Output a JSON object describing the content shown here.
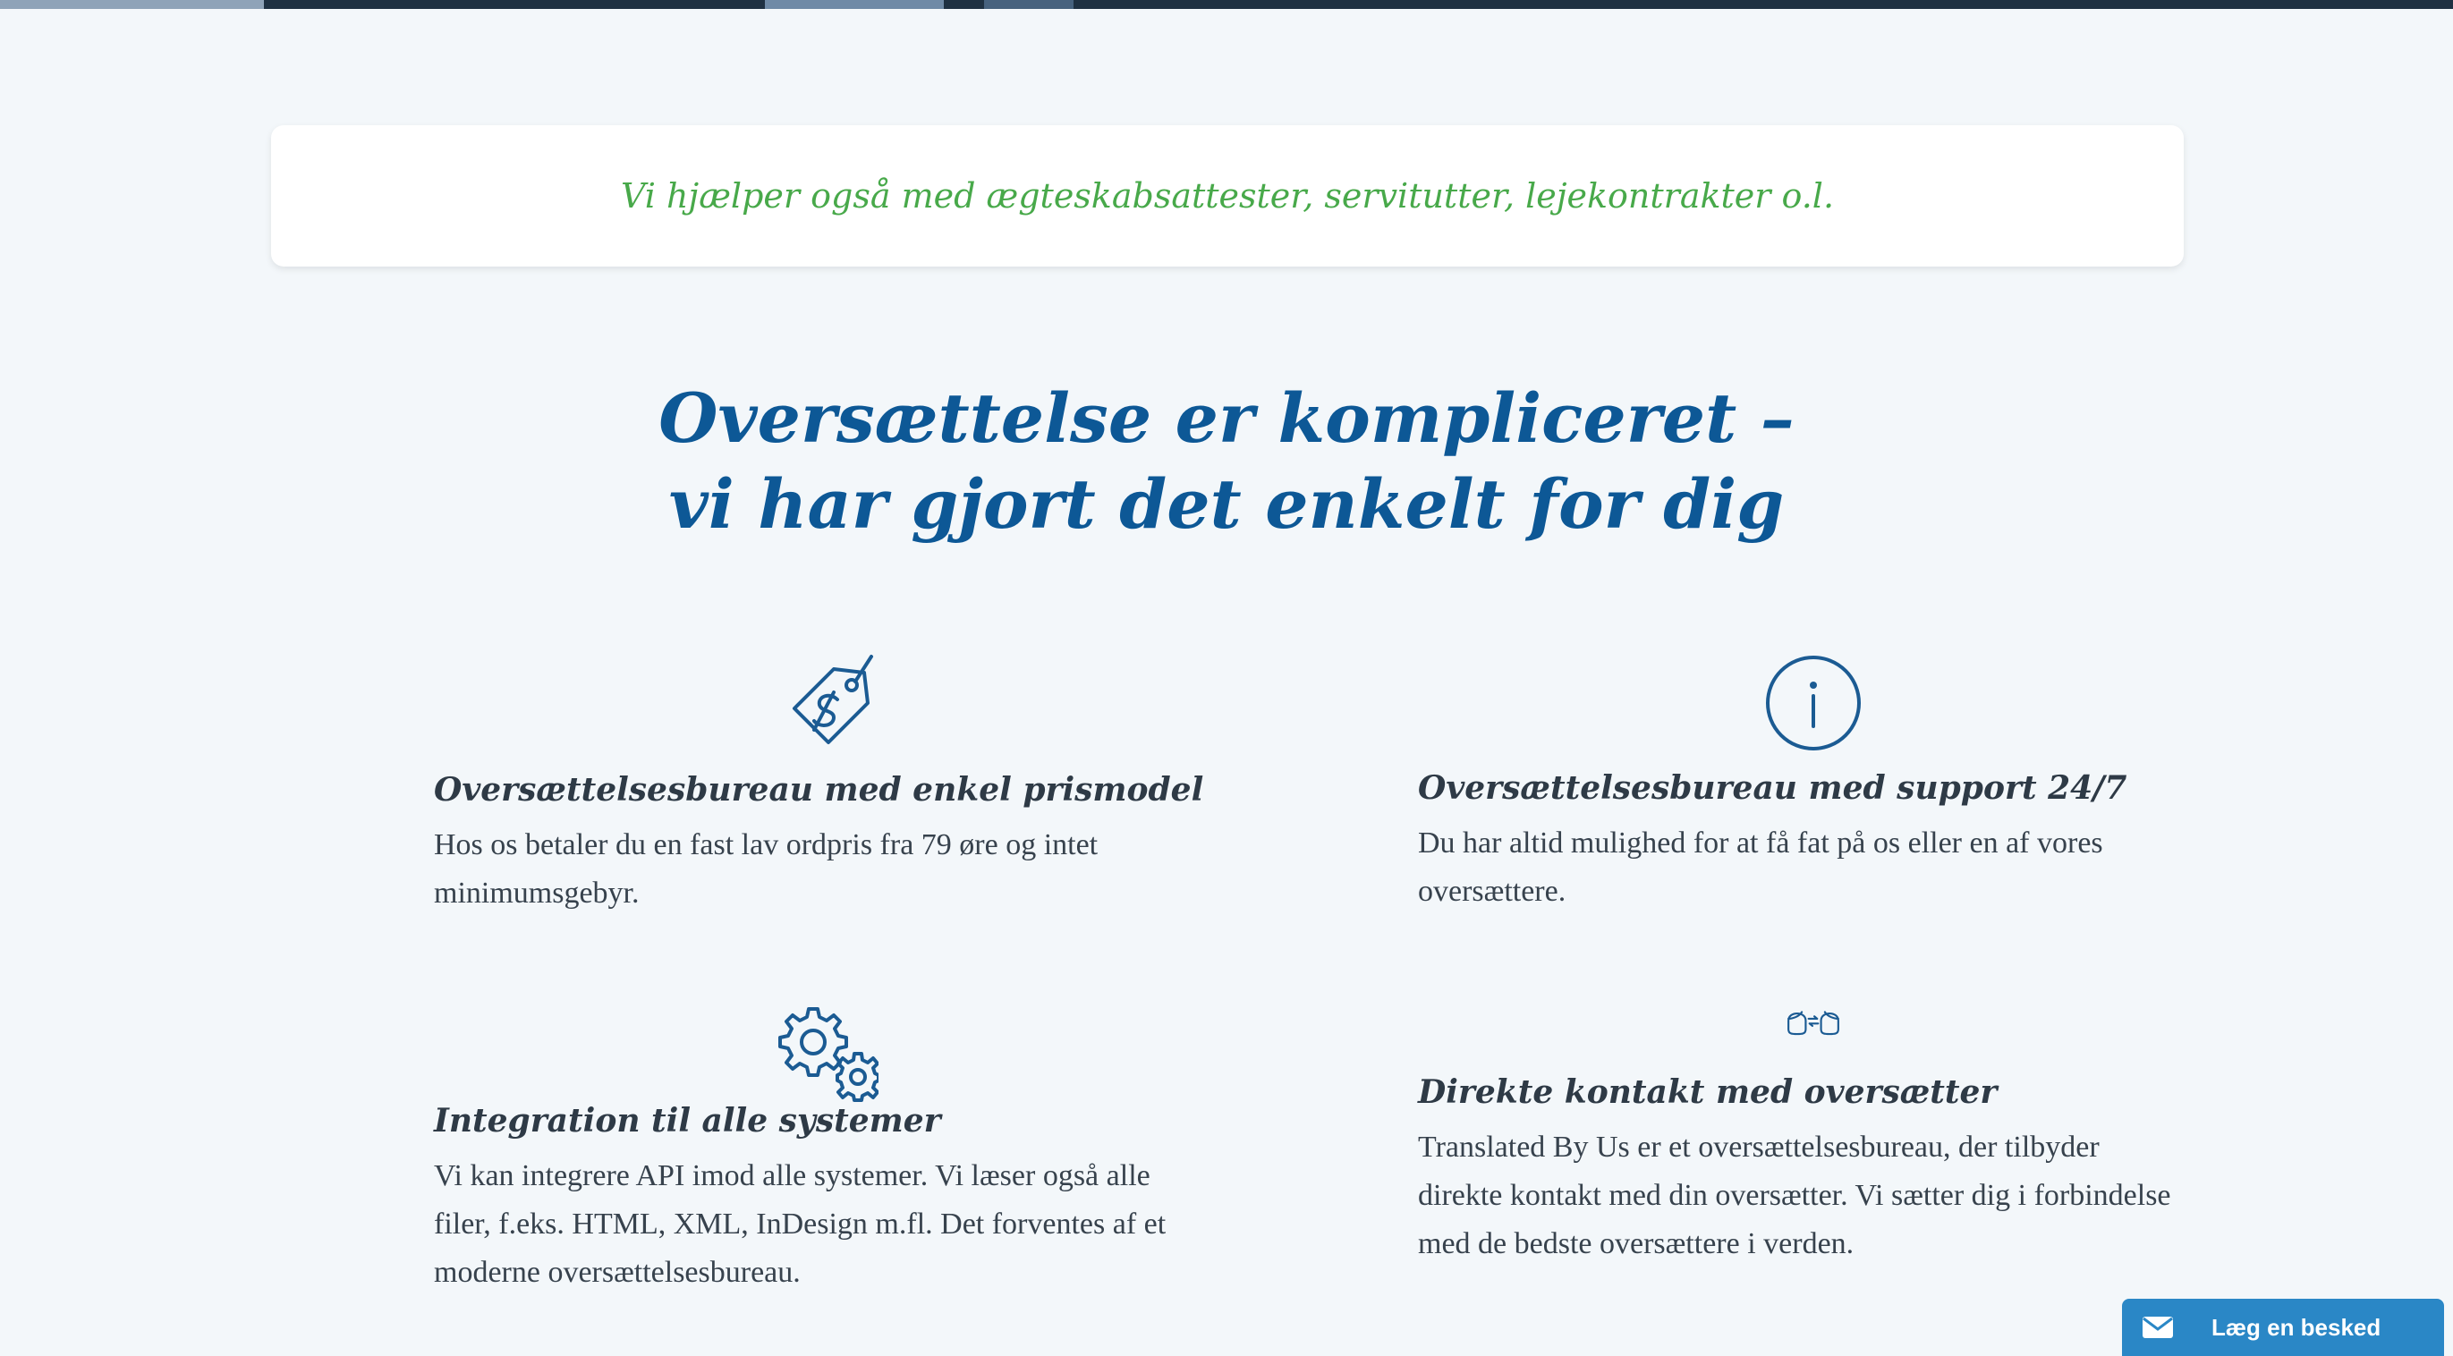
{
  "banner": {
    "text": "Vi hjælper også med ægteskabsattester, servitutter, lejekontrakter o.l."
  },
  "headline": {
    "line1": "Oversættelse er kompliceret –",
    "line2": "vi har gjort det enkelt for dig"
  },
  "features": [
    {
      "icon": "price-tag-icon",
      "title": "Oversættelsesbureau med enkel prismodel",
      "text": "Hos os betaler du en fast lav ordpris fra 79 øre og intet minimumsgebyr."
    },
    {
      "icon": "info-icon",
      "title": "Oversættelsesbureau med support 24/7",
      "text": "Du har altid mulighed for at få fat på os eller en af vores oversættere."
    },
    {
      "icon": "gears-icon",
      "title": "Integration til alle systemer",
      "text": "Vi kan integrere API imod alle systemer. Vi læser også alle filer, f.eks. HTML, XML, InDesign m.fl. Det forventes af et moderne oversættelsesbureau."
    },
    {
      "icon": "people-exchange-icon",
      "title": "Direkte kontakt med oversætter",
      "text": "Translated By Us er et oversættelsesbureau, der tilbyder direkte kontakt med din oversætter. Vi sætter dig i forbindelse med de bedste oversættere i verden."
    }
  ],
  "chat_widget": {
    "icon": "envelope-icon",
    "label": "Læg en besked"
  },
  "colors": {
    "page_background": "#f3f7fa",
    "banner_text": "#48a94a",
    "headline": "#0d5896",
    "icon_stroke": "#1b5b93",
    "body_text": "#37424d",
    "chat_widget": "#2a87c6"
  }
}
